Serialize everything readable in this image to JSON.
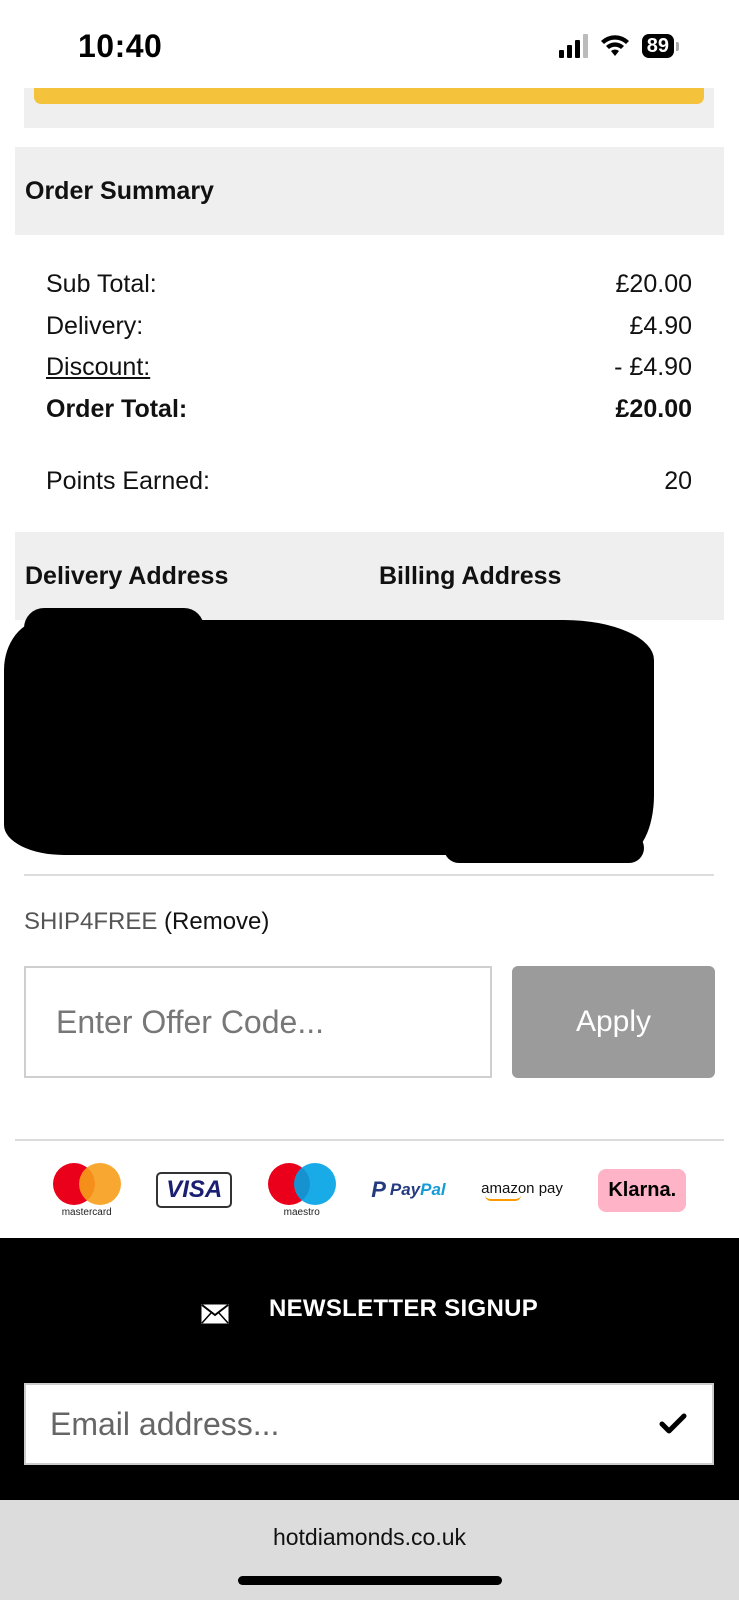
{
  "status_bar": {
    "time": "10:40",
    "battery": "89"
  },
  "order_summary": {
    "title": "Order Summary",
    "rows": [
      {
        "label": "Sub Total:",
        "value": "£20.00"
      },
      {
        "label": "Delivery:",
        "value": "£4.90"
      },
      {
        "label": "Discount:",
        "value": "- £4.90"
      },
      {
        "label": "Order Total:",
        "value": "£20.00"
      }
    ],
    "points_label": "Points Earned:",
    "points_value": "20"
  },
  "addresses": {
    "delivery_title": "Delivery Address",
    "billing_title": "Billing Address"
  },
  "promo": {
    "applied_code": "SHIP4FREE",
    "remove_label": "(Remove)"
  },
  "offer": {
    "placeholder": "Enter Offer Code...",
    "apply_label": "Apply"
  },
  "payments": {
    "mastercard_label": "mastercard",
    "visa_label": "VISA",
    "maestro_label": "maestro",
    "paypal_label_1": "Pay",
    "paypal_label_2": "Pal",
    "amazon_label": "amazon pay",
    "klarna_label": "Klarna."
  },
  "newsletter": {
    "title": "NEWSLETTER SIGNUP",
    "email_placeholder": "Email address..."
  },
  "browser": {
    "url": "hotdiamonds.co.uk"
  },
  "colors": {
    "accent_yellow": "#f5c23c",
    "apply_button": "#9b9b9b",
    "footer_bg": "#000000",
    "klarna_pink": "#ffb3c7"
  }
}
